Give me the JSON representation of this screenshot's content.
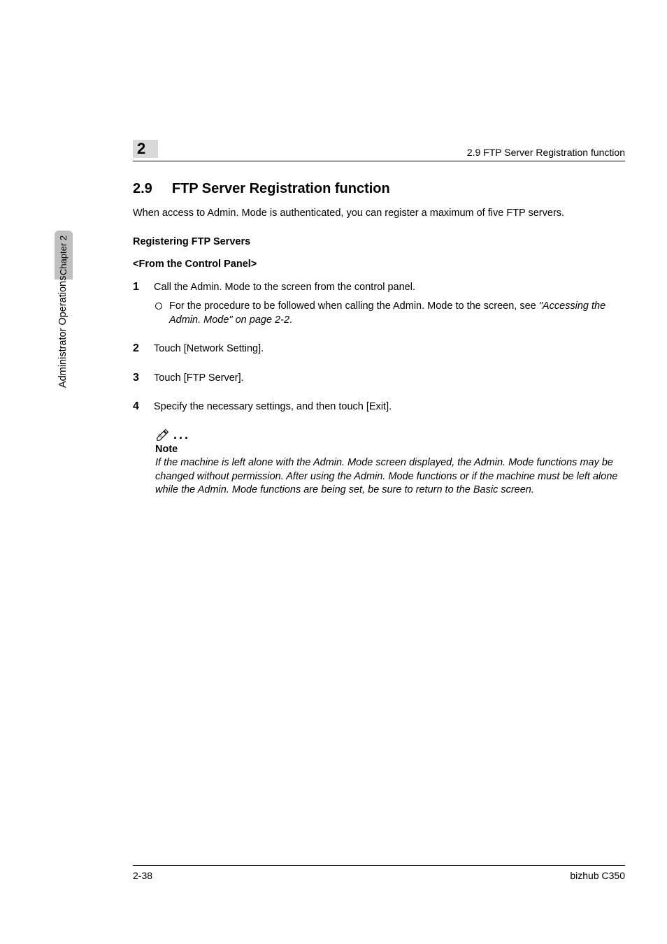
{
  "header": {
    "chapter_num": "2",
    "right_text": "2.9 FTP Server Registration function"
  },
  "side": {
    "tab_label": "Chapter 2",
    "vertical_label": "Administrator Operations"
  },
  "section": {
    "number": "2.9",
    "title": "FTP Server Registration function"
  },
  "intro": "When access to Admin. Mode is authenticated, you can register a maximum of five FTP servers.",
  "subhead1": "Registering FTP Servers",
  "subhead2": "<From the Control Panel>",
  "steps": {
    "s1": {
      "num": "1",
      "text": "Call the Admin. Mode to the screen from the control panel."
    },
    "s1_sub": {
      "prefix": "For the procedure to be followed when calling the Admin. Mode to the screen, see ",
      "italic": "\"Accessing the Admin. Mode\" on page 2-2",
      "suffix": "."
    },
    "s2": {
      "num": "2",
      "text": "Touch [Network Setting]."
    },
    "s3": {
      "num": "3",
      "text": "Touch [FTP Server]."
    },
    "s4": {
      "num": "4",
      "text": "Specify the necessary settings, and then touch [Exit]."
    }
  },
  "note": {
    "dots": "...",
    "label": "Note",
    "text": "If the machine is left alone with the Admin. Mode screen displayed, the Admin. Mode functions may be changed without permission. After using the Admin. Mode functions or if the machine must be left alone while the Admin. Mode functions are being set, be sure to return to the Basic screen."
  },
  "footer": {
    "left": "2-38",
    "right": "bizhub C350"
  }
}
